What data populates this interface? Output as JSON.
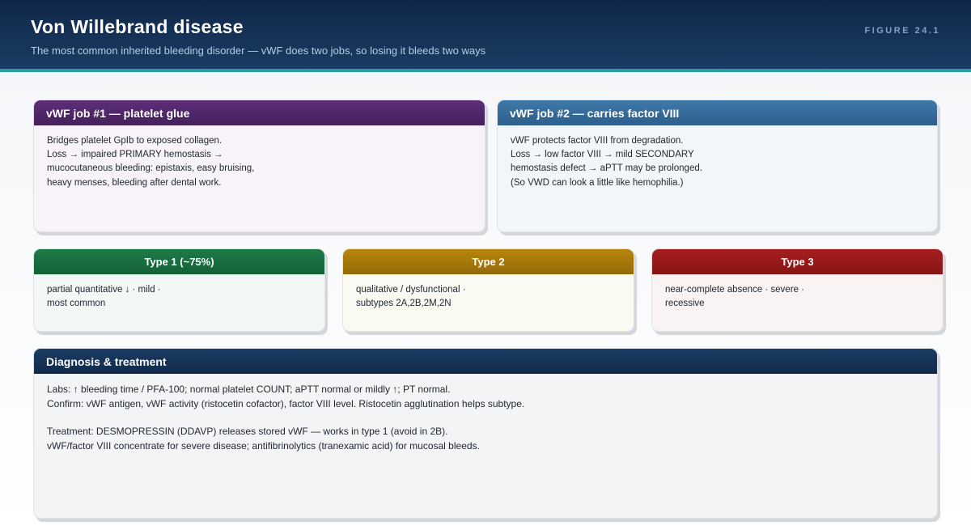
{
  "header": {
    "title": "Von Willebrand disease",
    "subtitle": "The most common inherited bleeding disorder — vWF does two jobs, so losing it bleeds two ways",
    "figure_label": "FIGURE 24.1"
  },
  "job1": {
    "title": "vWF job #1 — platelet glue",
    "lines": [
      "Bridges platelet GpIb to exposed collagen.",
      "Loss → impaired PRIMARY hemostasis →",
      "mucocutaneous bleeding: epistaxis, easy bruising,",
      "heavy menses, bleeding after dental work."
    ]
  },
  "job2": {
    "title": "vWF job #2 — carries factor VIII",
    "lines": [
      "vWF protects factor VIII from degradation.",
      "Loss → low factor VIII → mild SECONDARY",
      "hemostasis defect → aPTT may be prolonged.",
      "(So VWD can look a little like hemophilia.)"
    ]
  },
  "types": [
    {
      "title": "Type 1 (~75%)",
      "lines": [
        "partial quantitative ↓ · mild ·",
        "most common"
      ],
      "color": "#1e7a48"
    },
    {
      "title": "Type 2",
      "lines": [
        "qualitative / dysfunctional ·",
        "subtypes 2A,2B,2M,2N"
      ],
      "color": "#b8860b"
    },
    {
      "title": "Type 3",
      "lines": [
        "near-complete absence · severe ·",
        "recessive"
      ],
      "color": "#a61f1f"
    }
  ],
  "diagnosis": {
    "title": "Diagnosis & treatment",
    "lines": [
      "Labs: ↑ bleeding time / PFA-100; normal platelet COUNT; aPTT normal or mildly ↑; PT normal.",
      "Confirm: vWF antigen, vWF activity (ristocetin cofactor), factor VIII level. Ristocetin agglutination helps subtype.",
      "",
      "Treatment: DESMOPRESSIN (DDAVP) releases stored vWF — works in type 1 (avoid in 2B).",
      "vWF/factor VIII concentrate for severe disease; antifibrinolytics (tranexamic acid) for mucosal bleeds."
    ]
  },
  "colors": {
    "header": "#1a3c64",
    "stripe": "#2a9d98",
    "job1": "#5e2e7a",
    "job2": "#3f78a8"
  }
}
